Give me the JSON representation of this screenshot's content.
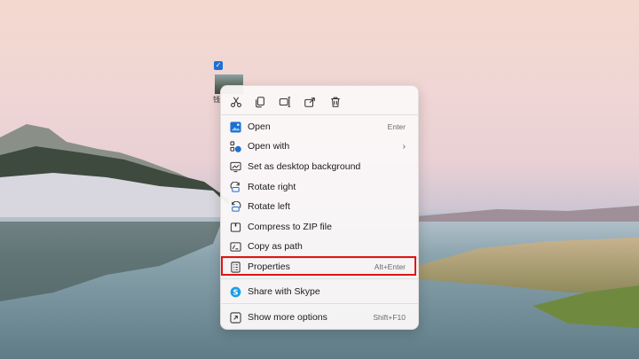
{
  "colors": {
    "accent": "#1f6fd6",
    "highlight_box": "#e01515",
    "menu_bg": "#faf7f7",
    "text": "#1b1b1b",
    "shortcut_text": "#6b6b6b"
  },
  "file": {
    "label": "钱"
  },
  "toolbar": [
    {
      "name": "cut",
      "icon": "scissors-icon"
    },
    {
      "name": "copy",
      "icon": "copy-icon"
    },
    {
      "name": "rename",
      "icon": "rename-icon"
    },
    {
      "name": "share",
      "icon": "share-icon"
    },
    {
      "name": "delete",
      "icon": "trash-icon"
    }
  ],
  "menu": {
    "items": [
      {
        "label": "Open",
        "shortcut": "Enter",
        "icon": "photos-icon"
      },
      {
        "label": "Open with",
        "shortcut": "",
        "submenu_indicator": "›",
        "icon": "open-with-icon"
      },
      {
        "label": "Set as desktop background",
        "shortcut": "",
        "icon": "desktop-background-icon"
      },
      {
        "label": "Rotate right",
        "shortcut": "",
        "icon": "rotate-right-icon"
      },
      {
        "label": "Rotate left",
        "shortcut": "",
        "icon": "rotate-left-icon"
      },
      {
        "label": "Compress to ZIP file",
        "shortcut": "",
        "icon": "zip-icon"
      },
      {
        "label": "Copy as path",
        "shortcut": "",
        "icon": "copy-path-icon"
      },
      {
        "label": "Properties",
        "shortcut": "Alt+Enter",
        "icon": "properties-icon",
        "highlighted": true
      },
      {
        "label": "Share with Skype",
        "shortcut": "",
        "icon": "skype-icon"
      },
      {
        "label": "Show more options",
        "shortcut": "Shift+F10",
        "icon": "more-options-icon"
      }
    ]
  }
}
